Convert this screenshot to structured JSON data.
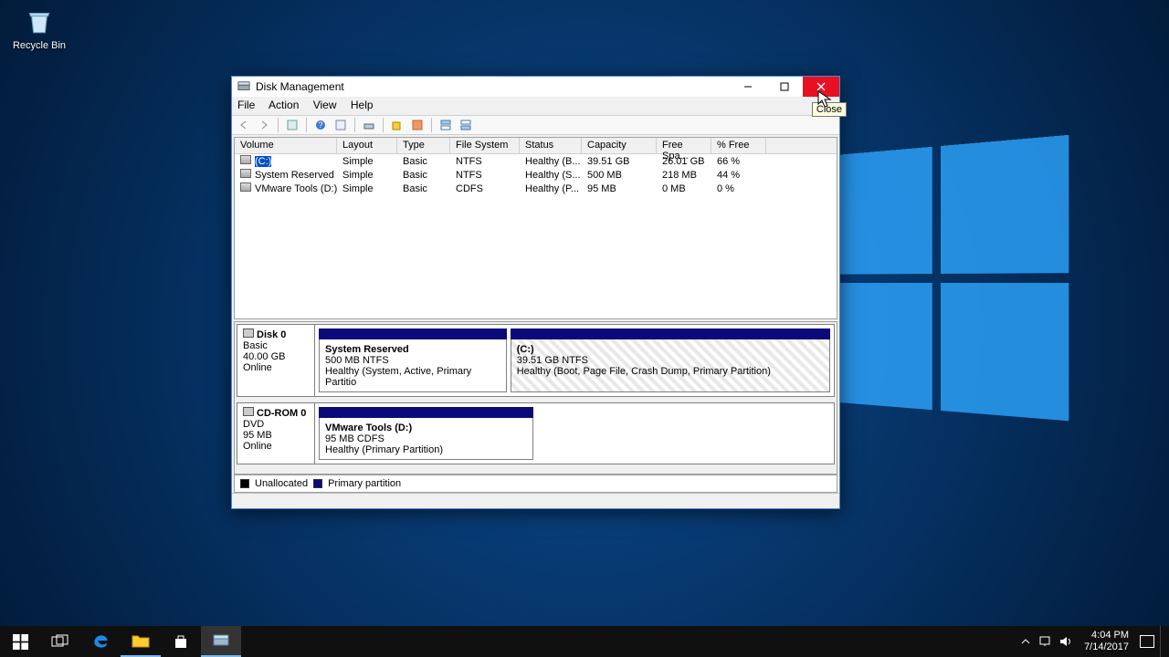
{
  "desktop": {
    "recycle_bin": "Recycle Bin"
  },
  "window": {
    "title": "Disk Management",
    "close_tooltip": "Close",
    "menu": [
      "File",
      "Action",
      "View",
      "Help"
    ],
    "columns": {
      "volume": "Volume",
      "layout": "Layout",
      "type": "Type",
      "fs": "File System",
      "status": "Status",
      "capacity": "Capacity",
      "free": "Free Spa...",
      "pct": "% Free"
    },
    "volumes": [
      {
        "name": "(C:)",
        "layout": "Simple",
        "type": "Basic",
        "fs": "NTFS",
        "status": "Healthy (B...",
        "capacity": "39.51 GB",
        "free": "26.01 GB",
        "pct": "66 %",
        "selected": true
      },
      {
        "name": "System Reserved",
        "layout": "Simple",
        "type": "Basic",
        "fs": "NTFS",
        "status": "Healthy (S...",
        "capacity": "500 MB",
        "free": "218 MB",
        "pct": "44 %"
      },
      {
        "name": "VMware Tools (D:)",
        "layout": "Simple",
        "type": "Basic",
        "fs": "CDFS",
        "status": "Healthy (P...",
        "capacity": "95 MB",
        "free": "0 MB",
        "pct": "0 %"
      }
    ],
    "disks": [
      {
        "label": "Disk 0",
        "type": "Basic",
        "size": "40.00 GB",
        "state": "Online",
        "partitions": [
          {
            "title": "System Reserved",
            "sub": "500 MB NTFS",
            "status": "Healthy (System, Active, Primary Partitio",
            "width": "37%",
            "hatched": false
          },
          {
            "title": "(C:)",
            "sub": "39.51 GB NTFS",
            "status": "Healthy (Boot, Page File, Crash Dump, Primary Partition)",
            "width": "63%",
            "hatched": true
          }
        ]
      },
      {
        "label": "CD-ROM 0",
        "type": "DVD",
        "size": "95 MB",
        "state": "Online",
        "partitions": [
          {
            "title": "VMware Tools  (D:)",
            "sub": "95 MB CDFS",
            "status": "Healthy (Primary Partition)",
            "width": "42%",
            "hatched": false
          }
        ]
      }
    ],
    "legend": {
      "unallocated": "Unallocated",
      "primary": "Primary partition"
    }
  },
  "taskbar": {
    "time": "4:04 PM",
    "date": "7/14/2017"
  }
}
